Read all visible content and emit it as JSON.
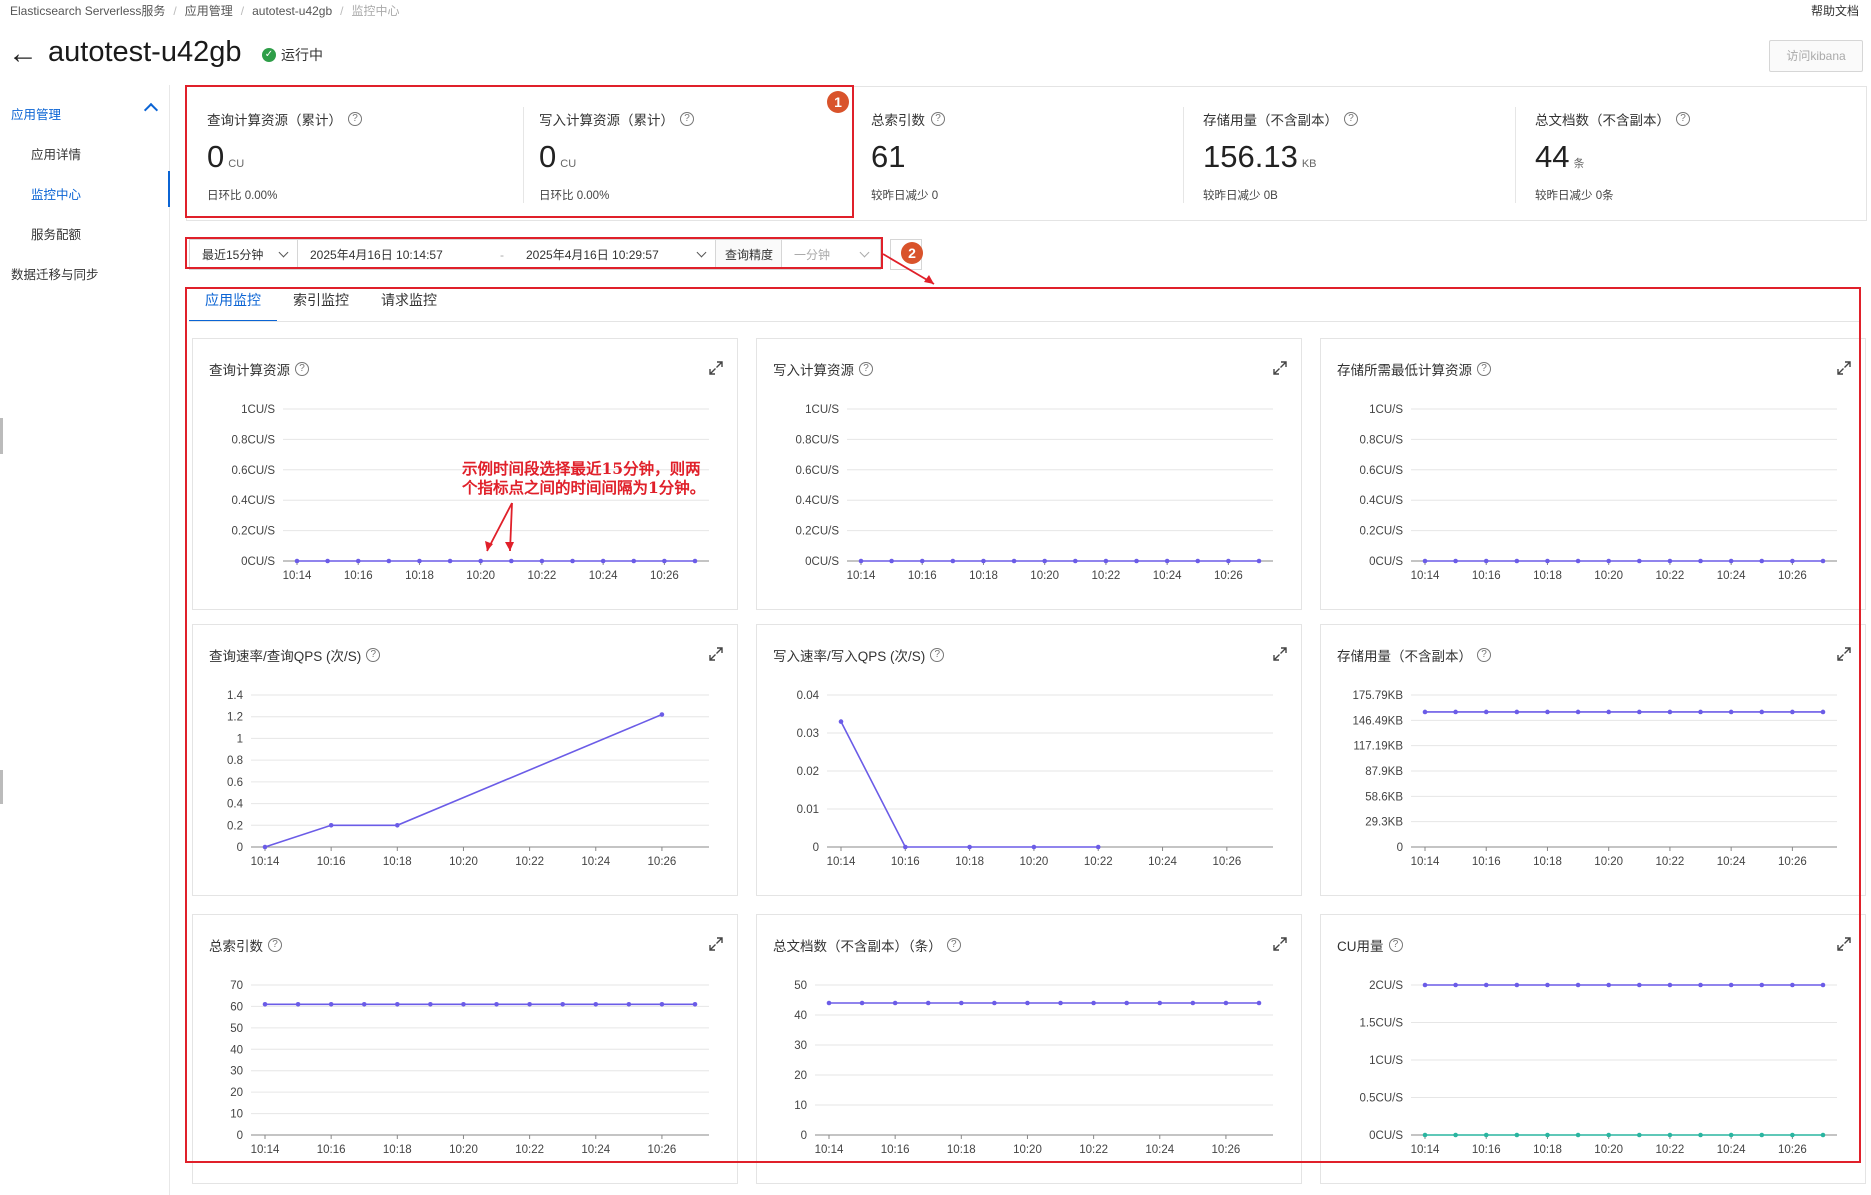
{
  "breadcrumb": [
    "Elasticsearch Serverless服务",
    "应用管理",
    "autotest-u42gb",
    "监控中心"
  ],
  "header": {
    "title": "autotest-u42gb",
    "status": "运行中",
    "help_link": "帮助文档",
    "kibana_button": "访问kibana"
  },
  "sidebar": {
    "group": "应用管理",
    "items": [
      "应用详情",
      "监控中心",
      "服务配额"
    ],
    "active_item": "监控中心",
    "bottom_item": "数据迁移与同步"
  },
  "stats": [
    {
      "label": "查询计算资源（累计）",
      "value": "0",
      "unit": "CU",
      "sub": "日环比  0.00%"
    },
    {
      "label": "写入计算资源（累计）",
      "value": "0",
      "unit": "CU",
      "sub": "日环比  0.00%"
    },
    {
      "label": "总索引数",
      "value": "61",
      "unit": "",
      "sub": "较昨日减少  0"
    },
    {
      "label": "存储用量（不含副本）",
      "value": "156.13",
      "unit": "KB",
      "sub": "较昨日减少  0B"
    },
    {
      "label": "总文档数（不含副本）",
      "value": "44",
      "unit": "条",
      "sub": "较昨日减少  0条"
    }
  ],
  "badges": [
    "1",
    "2"
  ],
  "filter": {
    "range": "最近15分钟",
    "start": "2025年4月16日 10:14:57",
    "sep": "-",
    "end": "2025年4月16日 10:29:57",
    "precision_label": "查询精度",
    "precision_value": "一分钟"
  },
  "tabs": [
    "应用监控",
    "索引监控",
    "请求监控"
  ],
  "active_tab": "应用监控",
  "annotation": "示例时间段选择最近15分钟，则两\n个指标点之间的时间间隔为1分钟。",
  "colors": {
    "accent": "#0b64d4",
    "series_purple": "#6b5ce7",
    "series_teal": "#2ab5a0",
    "highlight_red": "#e0202a",
    "status_green": "#2e9e48"
  },
  "chart_data": [
    {
      "type": "line",
      "title": "查询计算资源",
      "x": [
        "10:14",
        "10:15",
        "10:16",
        "10:17",
        "10:18",
        "10:19",
        "10:20",
        "10:21",
        "10:22",
        "10:23",
        "10:24",
        "10:25",
        "10:26",
        "10:27"
      ],
      "xticks": [
        "10:14",
        "10:16",
        "10:18",
        "10:20",
        "10:22",
        "10:24",
        "10:26"
      ],
      "yticks": [
        "0CU/S",
        "0.2CU/S",
        "0.4CU/S",
        "0.6CU/S",
        "0.8CU/S",
        "1CU/S"
      ],
      "ylim": [
        0,
        1
      ],
      "series": [
        {
          "values": [
            0,
            0,
            0,
            0,
            0,
            0,
            0,
            0,
            0,
            0,
            0,
            0,
            0,
            0
          ],
          "color": "#6b5ce7"
        }
      ]
    },
    {
      "type": "line",
      "title": "写入计算资源",
      "x": [
        "10:14",
        "10:15",
        "10:16",
        "10:17",
        "10:18",
        "10:19",
        "10:20",
        "10:21",
        "10:22",
        "10:23",
        "10:24",
        "10:25",
        "10:26",
        "10:27"
      ],
      "xticks": [
        "10:14",
        "10:16",
        "10:18",
        "10:20",
        "10:22",
        "10:24",
        "10:26"
      ],
      "yticks": [
        "0CU/S",
        "0.2CU/S",
        "0.4CU/S",
        "0.6CU/S",
        "0.8CU/S",
        "1CU/S"
      ],
      "ylim": [
        0,
        1
      ],
      "series": [
        {
          "values": [
            0,
            0,
            0,
            0,
            0,
            0,
            0,
            0,
            0,
            0,
            0,
            0,
            0,
            0
          ],
          "color": "#6b5ce7"
        }
      ]
    },
    {
      "type": "line",
      "title": "存储所需最低计算资源",
      "x": [
        "10:14",
        "10:15",
        "10:16",
        "10:17",
        "10:18",
        "10:19",
        "10:20",
        "10:21",
        "10:22",
        "10:23",
        "10:24",
        "10:25",
        "10:26",
        "10:27"
      ],
      "xticks": [
        "10:14",
        "10:16",
        "10:18",
        "10:20",
        "10:22",
        "10:24",
        "10:26"
      ],
      "yticks": [
        "0CU/S",
        "0.2CU/S",
        "0.4CU/S",
        "0.6CU/S",
        "0.8CU/S",
        "1CU/S"
      ],
      "ylim": [
        0,
        1
      ],
      "series": [
        {
          "values": [
            0,
            0,
            0,
            0,
            0,
            0,
            0,
            0,
            0,
            0,
            0,
            0,
            0,
            0
          ],
          "color": "#6b5ce7"
        }
      ]
    },
    {
      "type": "line",
      "title": "查询速率/查询QPS (次/S)",
      "x": [
        "10:14",
        "10:16",
        "10:18",
        "10:26"
      ],
      "xticks": [
        "10:14",
        "10:16",
        "10:18",
        "10:20",
        "10:22",
        "10:24",
        "10:26"
      ],
      "yticks": [
        "0",
        "0.2",
        "0.4",
        "0.6",
        "0.8",
        "1",
        "1.2",
        "1.4"
      ],
      "ylim": [
        0,
        1.4
      ],
      "series": [
        {
          "values": [
            0,
            0.2,
            0.2,
            1.22
          ],
          "color": "#6b5ce7"
        }
      ]
    },
    {
      "type": "line",
      "title": "写入速率/写入QPS (次/S)",
      "x": [
        "10:14",
        "10:16",
        "10:18",
        "10:20",
        "10:22"
      ],
      "xticks": [
        "10:14",
        "10:16",
        "10:18",
        "10:20",
        "10:22",
        "10:24",
        "10:26"
      ],
      "yticks": [
        "0",
        "0.01",
        "0.02",
        "0.03",
        "0.04"
      ],
      "ylim": [
        0,
        0.04
      ],
      "series": [
        {
          "values": [
            0.033,
            0,
            0,
            0,
            0
          ],
          "color": "#6b5ce7"
        }
      ]
    },
    {
      "type": "line",
      "title": "存储用量（不含副本）",
      "x": [
        "10:14",
        "10:15",
        "10:16",
        "10:17",
        "10:18",
        "10:19",
        "10:20",
        "10:21",
        "10:22",
        "10:23",
        "10:24",
        "10:25",
        "10:26",
        "10:27"
      ],
      "xticks": [
        "10:14",
        "10:16",
        "10:18",
        "10:20",
        "10:22",
        "10:24",
        "10:26"
      ],
      "yticks": [
        "0",
        "29.3KB",
        "58.6KB",
        "87.9KB",
        "117.19KB",
        "146.49KB",
        "175.79KB"
      ],
      "ylim": [
        0,
        6
      ],
      "series": [
        {
          "values": [
            5.33,
            5.33,
            5.33,
            5.33,
            5.33,
            5.33,
            5.33,
            5.33,
            5.33,
            5.33,
            5.33,
            5.33,
            5.33,
            5.33
          ],
          "color": "#6b5ce7"
        }
      ]
    },
    {
      "type": "line",
      "title": "总索引数",
      "x": [
        "10:14",
        "10:15",
        "10:16",
        "10:17",
        "10:18",
        "10:19",
        "10:20",
        "10:21",
        "10:22",
        "10:23",
        "10:24",
        "10:25",
        "10:26",
        "10:27"
      ],
      "xticks": [
        "10:14",
        "10:16",
        "10:18",
        "10:20",
        "10:22",
        "10:24",
        "10:26"
      ],
      "yticks": [
        "0",
        "10",
        "20",
        "30",
        "40",
        "50",
        "60",
        "70"
      ],
      "ylim": [
        0,
        70
      ],
      "series": [
        {
          "values": [
            61,
            61,
            61,
            61,
            61,
            61,
            61,
            61,
            61,
            61,
            61,
            61,
            61,
            61
          ],
          "color": "#6b5ce7"
        }
      ]
    },
    {
      "type": "line",
      "title": "总文档数（不含副本）（条）",
      "x": [
        "10:14",
        "10:15",
        "10:16",
        "10:17",
        "10:18",
        "10:19",
        "10:20",
        "10:21",
        "10:22",
        "10:23",
        "10:24",
        "10:25",
        "10:26",
        "10:27"
      ],
      "xticks": [
        "10:14",
        "10:16",
        "10:18",
        "10:20",
        "10:22",
        "10:24",
        "10:26"
      ],
      "yticks": [
        "0",
        "10",
        "20",
        "30",
        "40",
        "50"
      ],
      "ylim": [
        0,
        50
      ],
      "series": [
        {
          "values": [
            44,
            44,
            44,
            44,
            44,
            44,
            44,
            44,
            44,
            44,
            44,
            44,
            44,
            44
          ],
          "color": "#6b5ce7"
        }
      ]
    },
    {
      "type": "line",
      "title": "CU用量",
      "x": [
        "10:14",
        "10:15",
        "10:16",
        "10:17",
        "10:18",
        "10:19",
        "10:20",
        "10:21",
        "10:22",
        "10:23",
        "10:24",
        "10:25",
        "10:26",
        "10:27"
      ],
      "xticks": [
        "10:14",
        "10:16",
        "10:18",
        "10:20",
        "10:22",
        "10:24",
        "10:26"
      ],
      "yticks": [
        "0CU/S",
        "0.5CU/S",
        "1CU/S",
        "1.5CU/S",
        "2CU/S"
      ],
      "ylim": [
        0,
        2
      ],
      "series": [
        {
          "values": [
            2,
            2,
            2,
            2,
            2,
            2,
            2,
            2,
            2,
            2,
            2,
            2,
            2,
            2
          ],
          "color": "#6b5ce7"
        },
        {
          "values": [
            0,
            0,
            0,
            0,
            0,
            0,
            0,
            0,
            0,
            0,
            0,
            0,
            0,
            0
          ],
          "color": "#2ab5a0"
        }
      ]
    }
  ]
}
